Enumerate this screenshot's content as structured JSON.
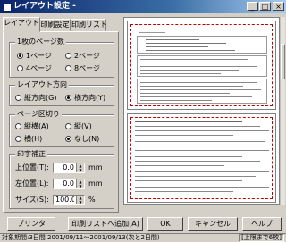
{
  "window": {
    "title": "レイアウト設定 -",
    "controls": {
      "minimize": "_",
      "maximize": "□",
      "close": "×"
    }
  },
  "tabs": [
    {
      "label": "レイアウト",
      "active": true
    },
    {
      "label": "印刷設定",
      "active": false
    },
    {
      "label": "印刷リスト",
      "active": false
    }
  ],
  "pages_per_sheet": {
    "legend": "1枚のページ数",
    "options": [
      {
        "label": "1ページ",
        "selected": true
      },
      {
        "label": "2ページ",
        "selected": false
      },
      {
        "label": "4ページ",
        "selected": false
      },
      {
        "label": "8ページ",
        "selected": false
      }
    ]
  },
  "layout_direction": {
    "legend": "レイアウト方向",
    "options": [
      {
        "label": "縦方向(G)",
        "selected": false
      },
      {
        "label": "横方向(Y)",
        "selected": true
      }
    ]
  },
  "page_split": {
    "legend": "ページ区切り",
    "options": [
      {
        "label": "縦横(A)",
        "selected": false
      },
      {
        "label": "縦(V)",
        "selected": false
      },
      {
        "label": "横(H)",
        "selected": false
      },
      {
        "label": "なし(N)",
        "selected": true
      }
    ]
  },
  "print_correction": {
    "legend": "印字補正",
    "top": {
      "label": "上位置(T):",
      "value": "0.0",
      "unit": "mm"
    },
    "left": {
      "label": "左位置(L):",
      "value": "0.0",
      "unit": "mm"
    },
    "size": {
      "label": "サイズ(S):",
      "value": "100.0",
      "unit": "%"
    }
  },
  "buttons": {
    "printer": "プリンタ",
    "add_to_print_list": "印刷リストへ追加(A)",
    "ok": "OK",
    "cancel": "キャンセル",
    "help": "ヘルプ"
  },
  "status": {
    "left": "対象期間:3日間 2001/09/11〜2001/09/13(次と2日間)",
    "right": "[上限まで6枚]"
  }
}
